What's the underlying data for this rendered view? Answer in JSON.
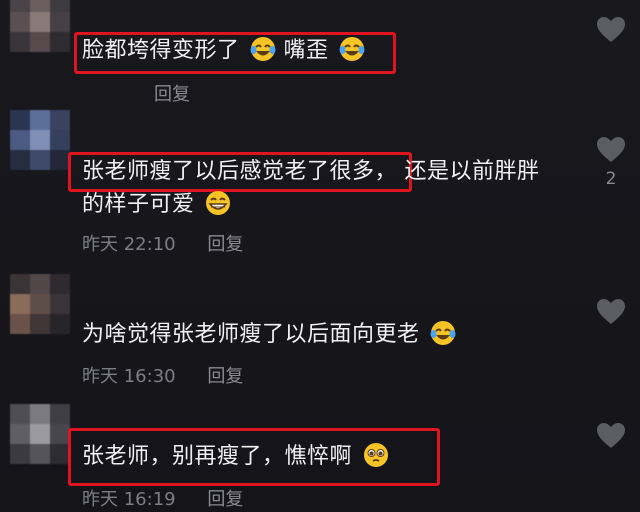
{
  "comments": [
    {
      "text": "脸都垮得变形了",
      "text_tail": "嘴歪",
      "emoji": "laughing-crying-emoji",
      "time": "",
      "reply_label": "回复",
      "likes": ""
    },
    {
      "text_highlighted": "张老师瘦了以后感觉老了很多，",
      "text_rest": "还是以前胖胖",
      "text_line2": "的样子可爱",
      "emoji": "grinning-emoji",
      "time": "昨天 22:10",
      "reply_label": "回复",
      "likes": "2"
    },
    {
      "text": "为啥觉得张老师瘦了以后面向更老",
      "emoji": "laughing-crying-emoji",
      "time": "昨天 16:30",
      "reply_label": "回复",
      "likes": ""
    },
    {
      "text": "张老师，别再瘦了，憔悴啊",
      "emoji": "pleading-emoji",
      "time": "昨天 16:19",
      "reply_label": "回复",
      "likes": ""
    }
  ],
  "colors": {
    "background": "#16161b",
    "text": "#f2f2f4",
    "meta": "#7d7d86",
    "highlight": "#e0141e",
    "heart": "#5c5c63"
  }
}
